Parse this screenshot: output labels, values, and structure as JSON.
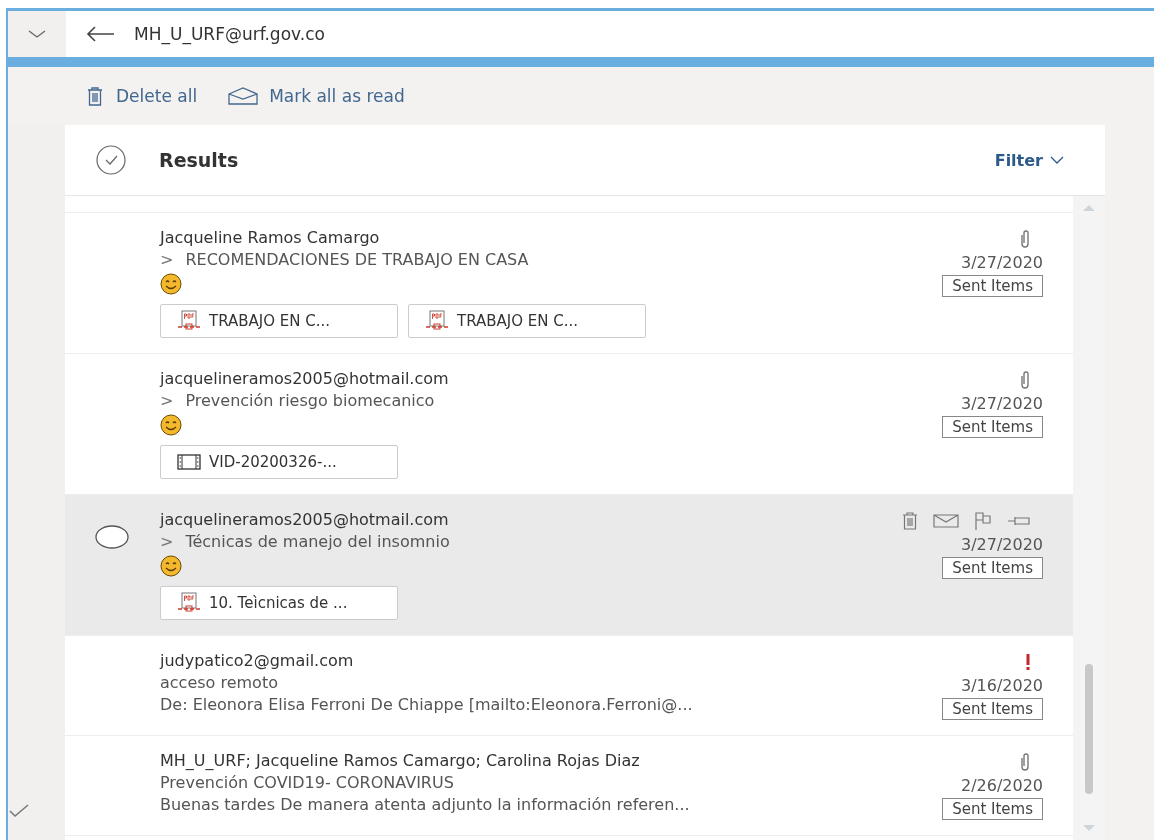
{
  "header": {
    "address": "MH_U_URF@urf.gov.co"
  },
  "toolbar": [
    {
      "kind": "delete",
      "label": "Delete all"
    },
    {
      "kind": "read",
      "label": "Mark all as read"
    }
  ],
  "results": {
    "title": "Results",
    "filter": "Filter"
  },
  "messages": [
    {
      "sender": "Jacqueline Ramos Camargo",
      "prefix": ">",
      "subject": "RECOMENDACIONES DE TRABAJO EN CASA",
      "preview_emoji": true,
      "has_attachment": true,
      "important": false,
      "date": "3/27/2020",
      "folder": "Sent Items",
      "hovered": false,
      "attachments": [
        {
          "kind": "pdf",
          "name": "TRABAJO EN C..."
        },
        {
          "kind": "pdf",
          "name": "TRABAJO EN C..."
        }
      ]
    },
    {
      "sender": "jacquelineramos2005@hotmail.com",
      "prefix": ">",
      "subject": "Prevención riesgo biomecanico",
      "preview_emoji": true,
      "has_attachment": true,
      "important": false,
      "date": "3/27/2020",
      "folder": "Sent Items",
      "hovered": false,
      "attachments": [
        {
          "kind": "video",
          "name": "VID-20200326-..."
        }
      ]
    },
    {
      "sender": "jacquelineramos2005@hotmail.com",
      "prefix": ">",
      "subject": "Técnicas de manejo del insomnio",
      "preview_emoji": true,
      "has_attachment": false,
      "important": false,
      "date": "3/27/2020",
      "folder": "Sent Items",
      "hovered": true,
      "attachments": [
        {
          "kind": "pdf",
          "name": "10. Teìcnicas de ..."
        }
      ]
    },
    {
      "sender": "judypatico2@gmail.com",
      "subject": "acceso remoto",
      "preview_emoji": false,
      "preview": "De: Eleonora Elisa Ferroni De Chiappe [mailto:Eleonora.Ferroni@...",
      "has_attachment": false,
      "important": true,
      "date": "3/16/2020",
      "folder": "Sent Items",
      "hovered": false
    },
    {
      "sender": "MH_U_URF; Jacqueline Ramos Camargo; Carolina Rojas Diaz",
      "subject": "Prevención COVID19- CORONAVIRUS",
      "preview_emoji": false,
      "preview": "Buenas tardes De manera atenta adjunto la información referen...",
      "has_attachment": true,
      "important": false,
      "date": "2/26/2020",
      "folder": "Sent Items",
      "hovered": false
    }
  ]
}
